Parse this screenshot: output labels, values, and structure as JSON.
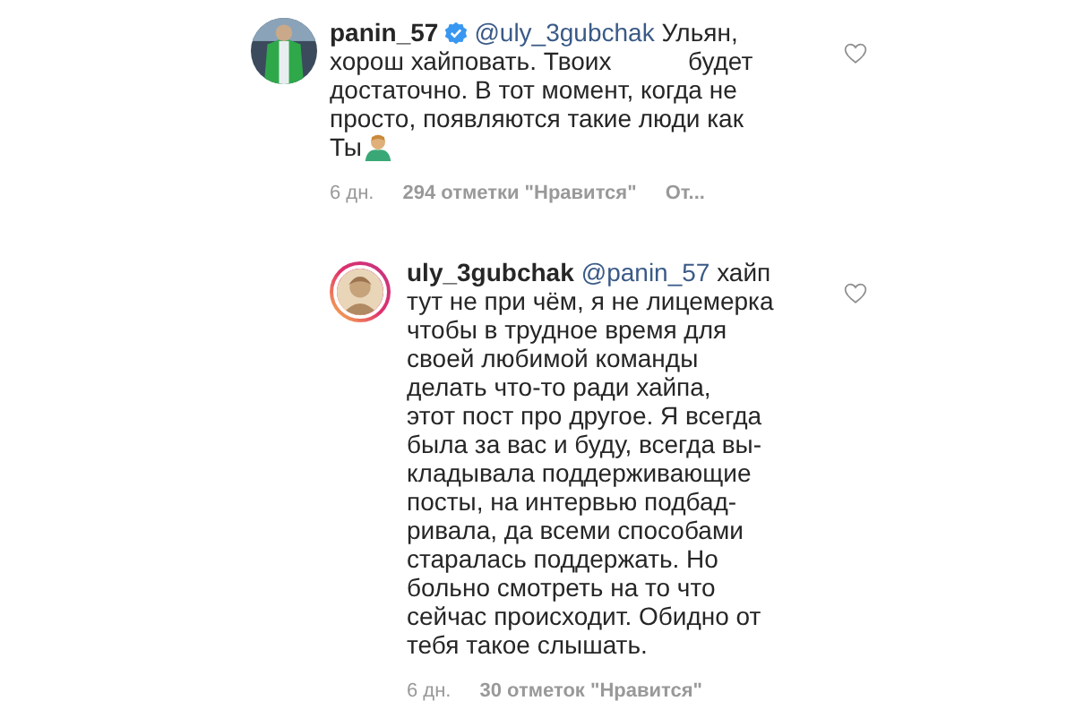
{
  "comments": [
    {
      "username": "panin_57",
      "verified": true,
      "story_ring": false,
      "mention": "@uly_3gubchak",
      "text": " Ульян,\nхорош хайповать. Твоих           будет\nдостаточно. В тот момент, когда не\nпросто, появляются такие люди как\nТы",
      "trailing_emoji": true,
      "time": "6 дн.",
      "likes": "294 отметки \"Нравится\"",
      "reply": "От...",
      "liked": false,
      "reply_level": false
    },
    {
      "username": "uly_3gubchak",
      "story_ring": true,
      "mention": "@panin_57",
      "text": " хайп\nтут не при чём, я не лицемерка\nчтобы в трудное время для\nсвоей любимой команды\nделать что-то ради хайпа,\nэтот пост про другое. Я всегда\nбыла за вас и буду, всегда вы-\nкладывала поддерживающие\nпосты, на интервью подбад-\nривала, да всеми способами\nстаралась поддержать. Но\nбольно смотреть на то что\nсейчас происходит. Обидно от\nтебя такое слышать.",
      "time": "6 дн.",
      "likes": "30 отметок \"Нравится\"",
      "liked": false,
      "reply_level": true
    }
  ]
}
